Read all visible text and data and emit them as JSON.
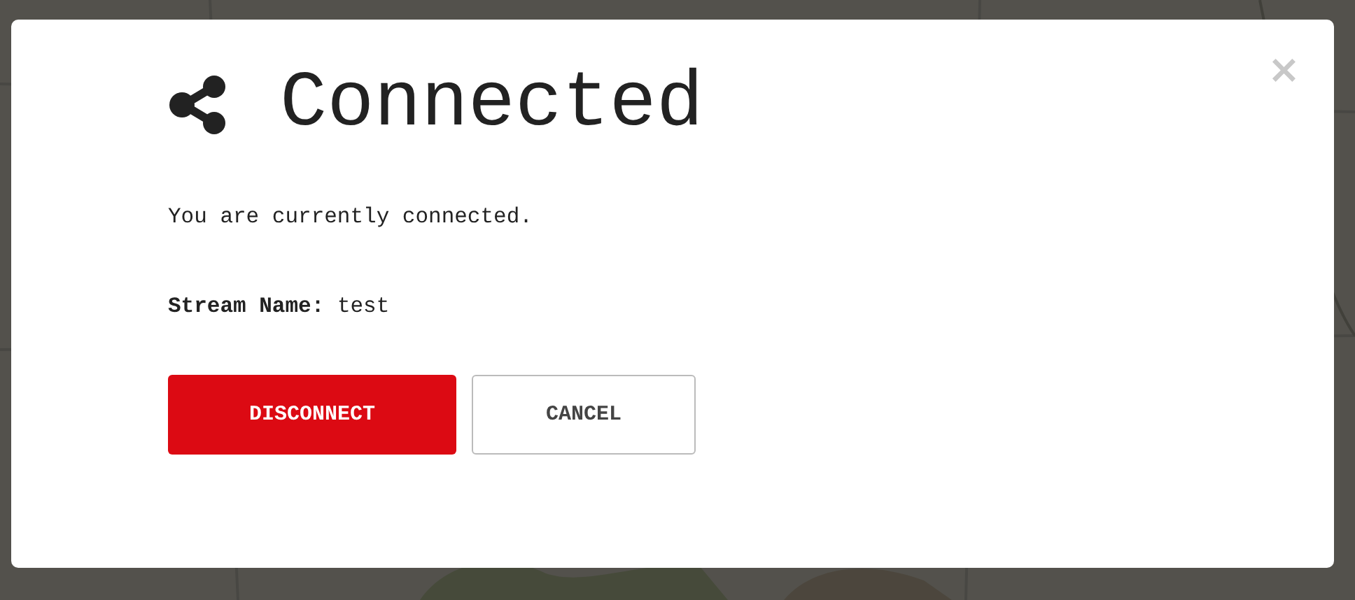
{
  "dialog": {
    "title": "Connected",
    "close": "×",
    "message": "You are currently connected.",
    "field": {
      "label": "Stream Name:",
      "value": "test"
    },
    "buttons": [
      {
        "label": "DISCONNECT",
        "kind": "primary"
      },
      {
        "label": "CANCEL",
        "kind": "secondary"
      }
    ]
  }
}
